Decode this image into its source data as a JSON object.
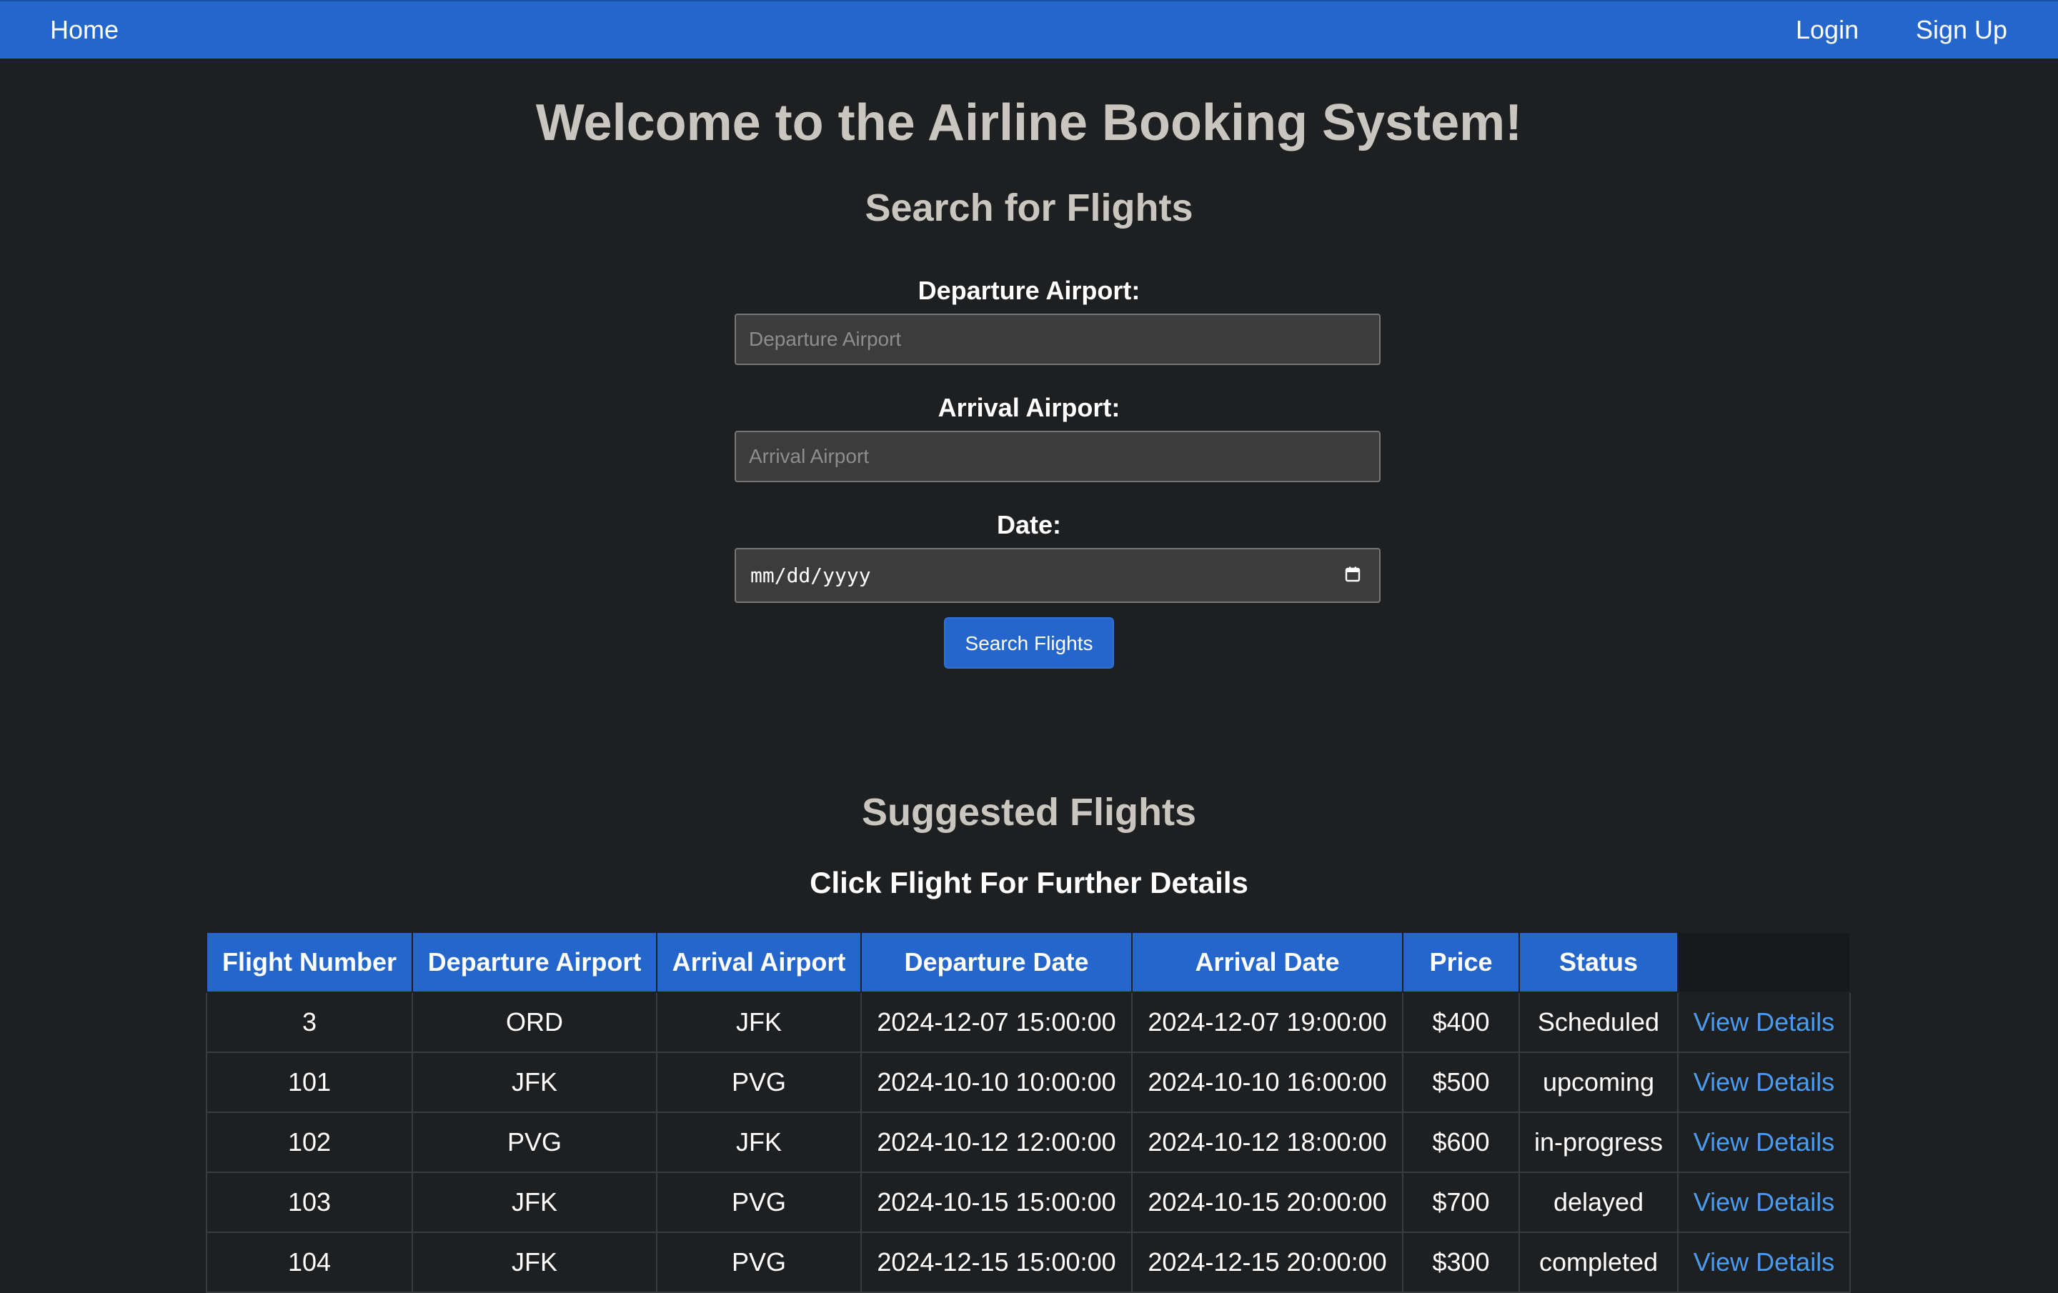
{
  "nav": {
    "home": "Home",
    "login": "Login",
    "signup": "Sign Up"
  },
  "page_title": "Welcome to the Airline Booking System!",
  "search": {
    "title": "Search for Flights",
    "departure_label": "Departure Airport:",
    "departure_placeholder": "Departure Airport",
    "arrival_label": "Arrival Airport:",
    "arrival_placeholder": "Arrival Airport",
    "date_label": "Date:",
    "date_placeholder": "mm/dd/yyyy",
    "button": "Search Flights"
  },
  "suggested": {
    "title": "Suggested Flights",
    "subtitle": "Click Flight For Further Details",
    "headers": [
      "Flight Number",
      "Departure Airport",
      "Arrival Airport",
      "Departure Date",
      "Arrival Date",
      "Price",
      "Status"
    ],
    "rows": [
      {
        "flight": "3",
        "dep": "ORD",
        "arr": "JFK",
        "dep_date": "2024-12-07 15:00:00",
        "arr_date": "2024-12-07 19:00:00",
        "price": "$400",
        "status": "Scheduled",
        "link": "View Details"
      },
      {
        "flight": "101",
        "dep": "JFK",
        "arr": "PVG",
        "dep_date": "2024-10-10 10:00:00",
        "arr_date": "2024-10-10 16:00:00",
        "price": "$500",
        "status": "upcoming",
        "link": "View Details"
      },
      {
        "flight": "102",
        "dep": "PVG",
        "arr": "JFK",
        "dep_date": "2024-10-12 12:00:00",
        "arr_date": "2024-10-12 18:00:00",
        "price": "$600",
        "status": "in-progress",
        "link": "View Details"
      },
      {
        "flight": "103",
        "dep": "JFK",
        "arr": "PVG",
        "dep_date": "2024-10-15 15:00:00",
        "arr_date": "2024-10-15 20:00:00",
        "price": "$700",
        "status": "delayed",
        "link": "View Details"
      },
      {
        "flight": "104",
        "dep": "JFK",
        "arr": "PVG",
        "dep_date": "2024-12-15 15:00:00",
        "arr_date": "2024-12-15 20:00:00",
        "price": "$300",
        "status": "completed",
        "link": "View Details"
      }
    ]
  },
  "colors": {
    "navbar": "#2466cc",
    "background": "#1e1f21",
    "link": "#4a9bf0",
    "heading": "#c9c6bf"
  }
}
